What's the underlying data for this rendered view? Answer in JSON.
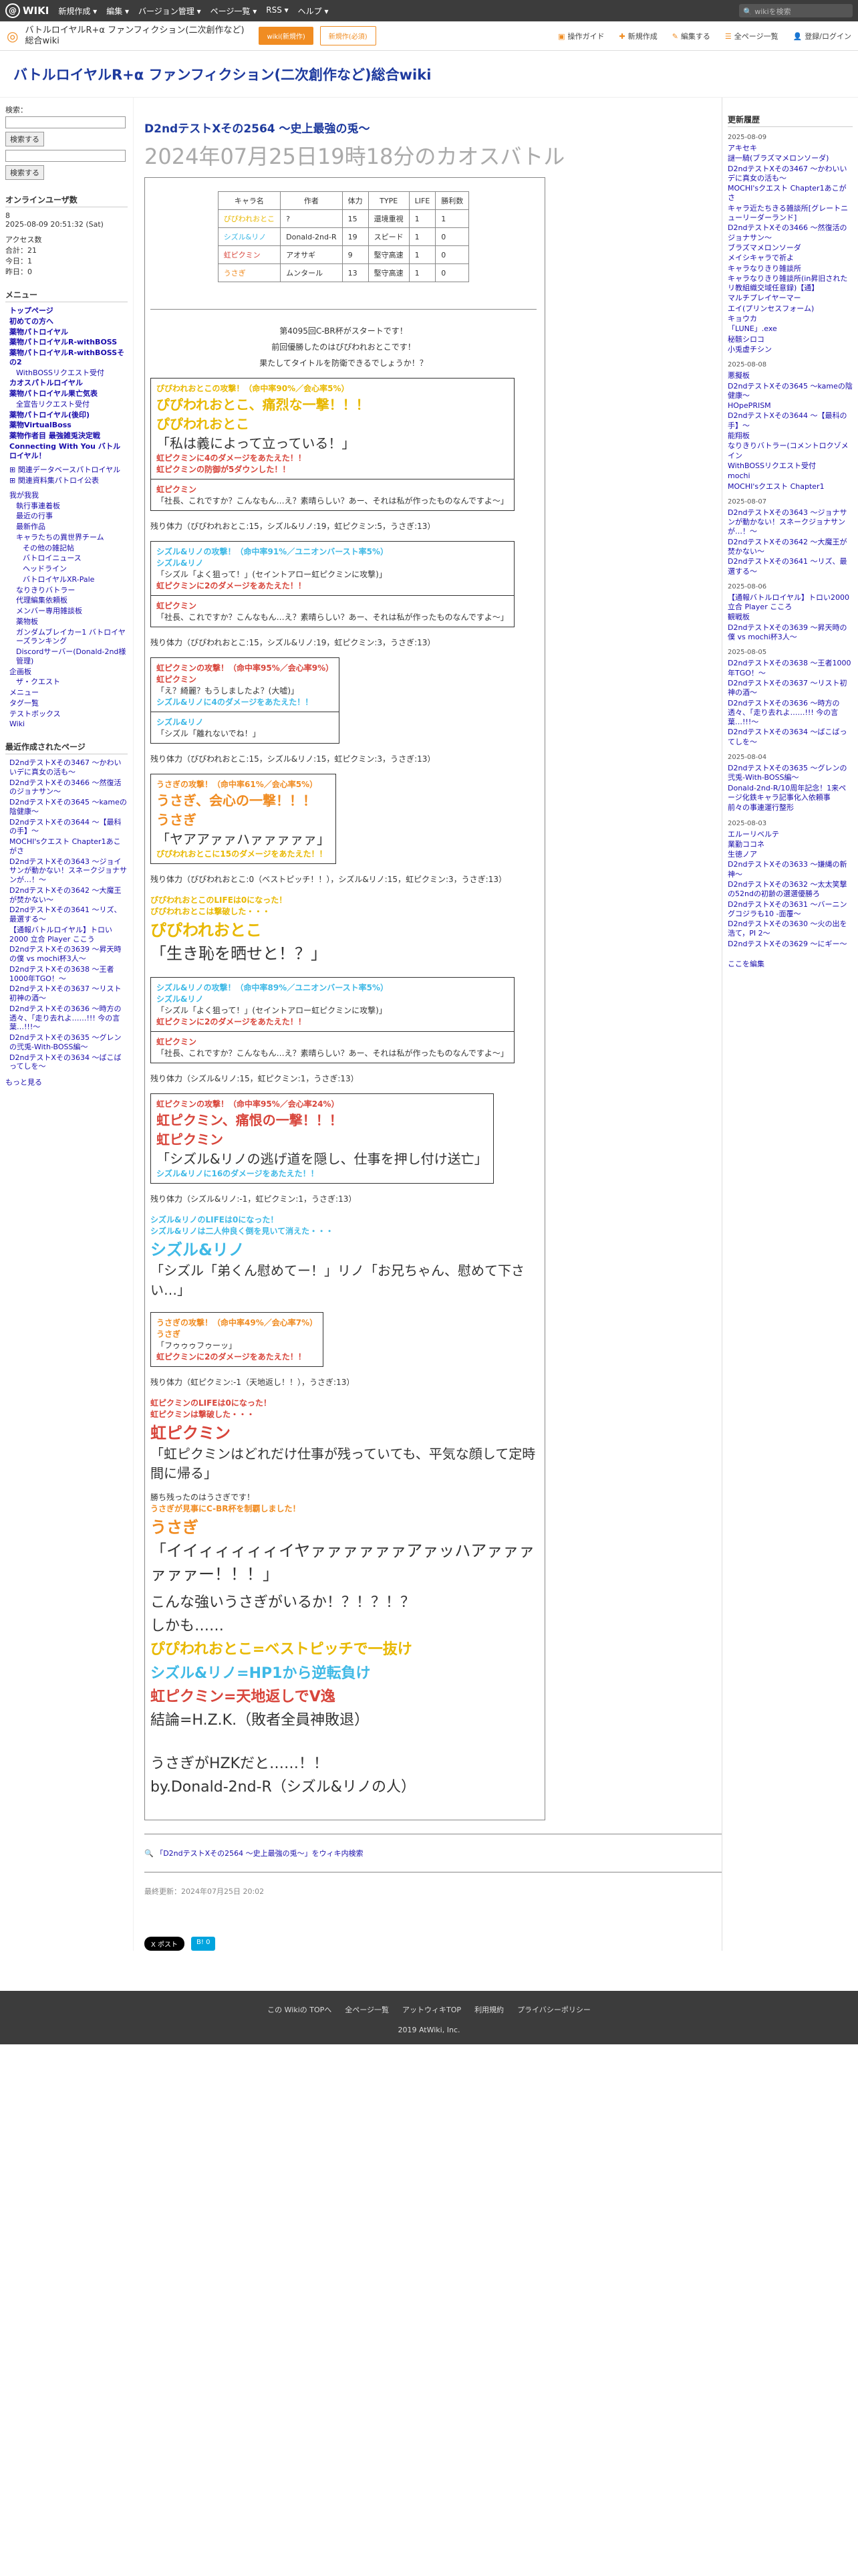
{
  "topbar": {
    "logo": "WIKI",
    "nav": [
      "新規作成 ▾",
      "編集 ▾",
      "バージョン管理 ▾",
      "ページ一覧 ▾",
      "RSS ▾",
      "ヘルプ ▾"
    ],
    "search": "wikiを検索"
  },
  "subbar": {
    "site": "バトルロイヤルR+α ファンフィクション(二次創作など)総合wiki",
    "btn1": "wiki(新規作)",
    "btn2": "新規作(必須)",
    "tools": [
      "操作ガイド",
      "新規作成",
      "編集する",
      "全ページ一覧",
      "登録/ログイン"
    ]
  },
  "banner": "バトルロイヤルR+α ファンフィクション(二次創作など)総合wiki",
  "left": {
    "search_label": "検索：",
    "search_btn": "検索する",
    "search2_btn": "検索する",
    "online": "オンラインユーザ数",
    "online_n": "8",
    "date": "2025-08-09 20:51:32 (Sat)",
    "access": [
      "アクセス数",
      "合計：21",
      "今日：1",
      "昨日：0"
    ],
    "menu_title": "メニュー",
    "menu": [
      "トップページ",
      "初めての方へ",
      "薬物パトロイヤル",
      "薬物パトロイヤルR-withBOSS",
      "薬物パトロイヤルR-withBOSSその2",
      "WithBOSSリクエスト受付",
      "カオスパトルロイヤル",
      "薬物パトロイヤル果亡気表",
      "全宣告リクエスト受付",
      "薬物パトロイヤル(後印)",
      "薬物VirtualBoss",
      "薬物作者目 最強雑兎決定戦",
      "Connecting With You バトルロイヤル！"
    ],
    "menu2": [
      "関連データベースパトロイヤル",
      "関連資料集パトロイ公表"
    ],
    "menu3": [
      "我が我我",
      "執行事連着板",
      "最近の行事",
      "最新作品",
      "キャラたちの異世界チーム",
      "その他の雑記帖",
      "バトロイニュース",
      "ヘッドライン",
      "バトロイヤルXR-Pale",
      "なりきりバトラー",
      "代理編集依頼板",
      "メンバー専用雑談板",
      "薬物板",
      "ガンダムブレイカー1 バトロイヤーズランキング",
      "Discordサーバー(Donald-2nd様管理)"
    ],
    "menu4": [
      "企画板",
      "ザ・クエスト"
    ],
    "menu5": [
      "メニュー",
      "タグ一覧",
      "テストボックス",
      "Wiki"
    ],
    "recent_title": "最近作成されたページ",
    "recent": [
      "D2ndテストXその3467 〜かわいいデに真女の活も〜",
      "D2ndテストXその3466 〜然復活のジョナサン〜",
      "D2ndテストXその3645 〜kameの陰健康〜",
      "D2ndテストXその3644 〜【最科の手】〜",
      "MOCHI'sクエスト Chapter1あこがさ",
      "D2ndテストXその3643 〜ジョイサンが動かない！スネークジョナサンが…！〜",
      "D2ndテストXその3642 〜大魔王が焚かない〜",
      "D2ndテストXその3641 〜リズ、最選する〜",
      "【通報バトルロイヤル】トロい2000 立合 Player ここう",
      "D2ndテストXその3639 〜昇天時の僕 vs mochi杯3人〜",
      "D2ndテストXその3638 〜王者1000年TGO！〜",
      "D2ndテストXその3637 〜リスト初神の酒〜",
      "D2ndテストXその3636 〜時方の透々、「走り去れよ……!!! 今の言葉…!!!〜",
      "D2ndテストXその3635 〜グレンの弐兎-With-BOSS編〜",
      "D2ndテストXその3634 〜ばこばってしを〜"
    ],
    "more": "もっと見る"
  },
  "main": {
    "subtitle": "D2ndテストXその2564 〜史上最強の兎〜",
    "title": "2024年07月25日19時18分のカオスバトル",
    "table": {
      "headers": [
        "キャラ名",
        "作者",
        "体力",
        "TYPE",
        "LIFE",
        "勝利数"
      ],
      "rows": [
        [
          "ぴぴわれおとこ",
          "?",
          "15",
          "還境重視",
          "1",
          "1"
        ],
        [
          "シズル&リノ",
          "Donald-2nd-R",
          "19",
          "スピード",
          "1",
          "0"
        ],
        [
          "虹ピクミン",
          "アオサギ",
          "9",
          "堅守高速",
          "1",
          "0"
        ],
        [
          "うさぎ",
          "ムンタール",
          "13",
          "堅守高速",
          "1",
          "0"
        ]
      ]
    },
    "intro": [
      "第4095回C-BR杯がスタートです！",
      "前回優勝したのはぴぴわれおとこです！",
      "果たしてタイトルを防衛できるでしょうか！？"
    ],
    "b1": [
      "ぴぴわれおとこの攻撃！（命中率90%／会心率5%）",
      "ぴぴわれおとこ、痛烈な一撃！！！",
      "ぴぴわれおとこ",
      "「私は義によって立っている！」",
      "虹ピクミンに4のダメージをあたえた！！",
      "虹ピクミンの防御が5ダウンした！！",
      "虹ピクミン",
      "「社長、これですか？こんなもん…え？素晴らしい？あー、それは私が作ったものなんですよ～」"
    ],
    "r1": "残り体力（ぴぴわれおとこ:15，シズル&リノ:19，虹ピクミン:5，うさぎ:13）",
    "b2": [
      "シズル&リノの攻撃！（命中率91%／ユニオンバースト率5%）",
      "シズル&リノ",
      "「シズル「よく狙って！」(セイントアロー虹ピクミンに攻撃)」",
      "虹ピクミンに2のダメージをあたえた！！",
      "虹ピクミン",
      "「社長、これですか？こんなもん…え？素晴らしい？あー、それは私が作ったものなんですよ～」"
    ],
    "r2": "残り体力（ぴぴわれおとこ:15，シズル&リノ:19，虹ピクミン:3，うさぎ:13）",
    "b3": [
      "虹ピクミンの攻撃！（命中率95%／会心率9%）",
      "虹ピクミン",
      "「え？綺麗？もうしましたよ？(大嘘)」",
      "シズル&リノに4のダメージをあたえた！！",
      "シズル&リノ",
      "「シズル「離れないでね！」"
    ],
    "r3": "残り体力（ぴぴわれおとこ:15，シズル&リノ:15，虹ピクミン:3，うさぎ:13）",
    "b4": [
      "うさぎの攻撃！（命中率61%／会心率5%）",
      "うさぎ、会心の一撃！！！",
      "うさぎ",
      "「ヤアアァァハァァァァァ」",
      "ぴぴわれおとこに15のダメージをあたえた！！"
    ],
    "r4": "残り体力（ぴぴわれおとこ:0（ベストピッチ！！），シズル&リノ:15，虹ピクミン:3，うさぎ:13）",
    "death1": [
      "ぴぴわれおとこのLIFEは0になった！",
      "ぴぴわれおとこは撃破した・・・",
      "ぴぴわれおとこ",
      "「生き恥を晒せと！？」"
    ],
    "b5": [
      "シズル&リノの攻撃！（命中率89%／ユニオンバースト率5%）",
      "シズル&リノ",
      "「シズル「よく狙って！」(セイントアロー虹ピクミンに攻撃)」",
      "虹ピクミンに2のダメージをあたえた！！",
      "虹ピクミン",
      "「社長、これですか？こんなもん…え？素晴らしい？あー、それは私が作ったものなんですよ～」"
    ],
    "r5": "残り体力（シズル&リノ:15，虹ピクミン:1，うさぎ:13）",
    "b6": [
      "虹ピクミンの攻撃！（命中率95%／会心率24%）",
      "虹ピクミン、痛恨の一撃！！！",
      "虹ピクミン",
      "「シズル&リノの逃げ道を隠し、仕事を押し付け送亡」",
      "シズル&リノに16のダメージをあたえた！！"
    ],
    "r6": "残り体力（シズル&リノ:-1，虹ピクミン:1，うさぎ:13）",
    "death2": [
      "シズル&リノのLIFEは0になった！",
      "シズル&リノは二人仲良く倒を見いて消えた・・・",
      "シズル&リノ",
      "「シズル「弟くん慰めてー！」リノ「お兄ちゃん、慰めて下さい…」"
    ],
    "b7": [
      "うさぎの攻撃！（命中率49%／会心率7%）",
      "うさぎ",
      "「フゥゥゥフゥーッ」",
      "虹ピクミンに2のダメージをあたえた！！"
    ],
    "r7": "残り体力（虹ピクミン:-1（天地返し！！），うさぎ:13）",
    "death3": [
      "虹ピクミンのLIFEは0になった！",
      "虹ピクミンは撃破した・・・",
      "虹ピクミン",
      "「虹ピクミンはどれだけ仕事が残っていても、平気な顔して定時間に帰る」"
    ],
    "win": [
      "勝ち残ったのはうさぎです！",
      "うさぎが見事にC-BR杯を制覇しました！",
      "うさぎ",
      "「イイィィィィィイヤァァァァァァアァッハアァァァァァァー！！！」"
    ],
    "closing": [
      "こんな強いうさぎがいるか！？！？！？",
      "しかも……",
      "ぴぴわれおとこ=ベストピッチで一抜け",
      "シズル&リノ=HP1から逆転負け",
      "虹ピクミン=天地返しでV逸",
      "結論=H.Z.K.（敗者全員神敗退）",
      "",
      "うさぎがHZKだと……！！",
      "by.Donald-2nd-R（シズル&リノの人）"
    ],
    "search_link": "「D2ndテストXその2564 〜史上最強の兎〜」をウィキ内検索",
    "updated": "最終更新：2024年07月25日 20:02",
    "share": [
      "X ポスト",
      "B! 0"
    ]
  },
  "right": {
    "title": "更新履歴",
    "groups": [
      {
        "date": "2025-08-09",
        "items": [
          "アキセキ",
          "謎一騎(ブラズマメロンソーダ)",
          "D2ndテストXその3467 〜かわいいデに真女の活も〜",
          "MOCHI'sクエスト Chapter1あこがさ",
          "キャラ近たちきる雑談所[グレートニューリーダーランド]",
          "D2ndテストXその3466 〜然復活のジョナサン〜",
          "ブラズマメロンソーダ",
          "メイシキャラで祈よ",
          "キャラなりきり雑談所",
          "キャラなりきり雑談所(in昇旧されたリ教組織交域任意録)【通】",
          "マルチプレイヤーマー",
          "エイ(プリンセスフォーム)",
          "キョウカ",
          "「LUNE」.exe",
          "秘骸シロコ",
          "小兎虚チシン"
        ]
      },
      {
        "date": "2025-08-08",
        "items": [
          "悪擬板",
          "D2ndテストXその3645 〜kameの陰健康〜",
          "HOpePRISM",
          "D2ndテストXその3644 〜【最科の手】〜",
          "能翔板",
          "なりきりバトラー(コメントロクゾメイン",
          "WithBOSSリクエスト受付",
          "mochi",
          "MOCHI'sクエスト Chapter1"
        ]
      },
      {
        "date": "2025-08-07",
        "items": [
          "D2ndテストXその3643 〜ジョナサンが動かない！スネークジョナサンが…！〜",
          "D2ndテストXその3642 〜大魔王が焚かない〜",
          "D2ndテストXその3641 〜リズ、最選する〜"
        ]
      },
      {
        "date": "2025-08-06",
        "items": [
          "【通報バトルロイヤル】トロい2000 立合 Player こころ",
          "観戦板",
          "D2ndテストXその3639 〜昇天時の僕 vs mochi杯3人〜"
        ]
      },
      {
        "date": "2025-08-05",
        "items": [
          "D2ndテストXその3638 〜王者1000年TGO！〜",
          "D2ndテストXその3637 〜リスト初神の酒〜",
          "D2ndテストXその3636 〜時方の透々、「走り去れよ……!!! 今の言葉…!!!〜",
          "D2ndテストXその3634 〜ばこばってしを〜"
        ]
      },
      {
        "date": "2025-08-04",
        "items": [
          "D2ndテストXその3635 〜グレンの弐兎-With-BOSS編〜",
          "Donald-2nd-R/10周年記念！1来ページ化鉄キャラ記事化入依頼事",
          "前々の事連運行整形"
        ]
      },
      {
        "date": "2025-08-03",
        "items": [
          "エルーリベルテ",
          "業勤ココネ",
          "生徳ノア",
          "D2ndテストXその3633 〜嫌縄の新神〜",
          "D2ndテストXその3632 〜太太笑撃の52ndの初齢の選選優勝ろ",
          "D2ndテストXその3631 〜バーニングコジラも10 -面覆〜",
          "D2ndテストXその3630 〜火の出を浩て，PI 2〜",
          "D2ndテストXその3629 〜にギー〜"
        ]
      }
    ],
    "more": "ここを編集"
  },
  "footer": {
    "links": [
      "この Wikiの TOPへ",
      "全ページ一覧",
      "アットウィキTOP",
      "利用規約",
      "プライバシーポリシー"
    ],
    "copy": "2019 AtWiki, Inc."
  }
}
